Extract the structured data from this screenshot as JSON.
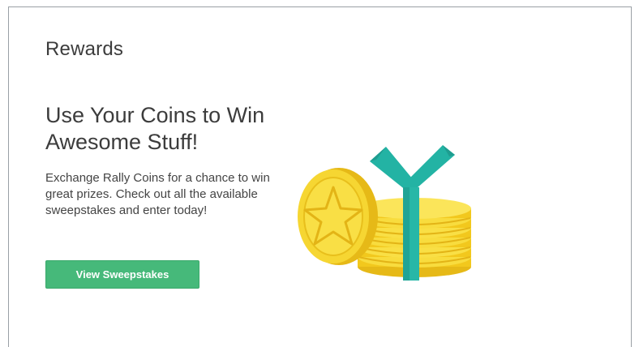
{
  "rewards": {
    "section_title": "Rewards",
    "headline": "Use Your Coins to Win Awesome Stuff!",
    "description": "Exchange Rally Coins for a chance to win great prizes. Check out all the available sweepstakes and enter today!",
    "cta_label": "View Sweepstakes"
  },
  "colors": {
    "button": "#46b97a",
    "coin": "#f4d231",
    "ribbon": "#23b3a4"
  },
  "icons": {
    "illustration": "coin-stack-gift-icon"
  }
}
